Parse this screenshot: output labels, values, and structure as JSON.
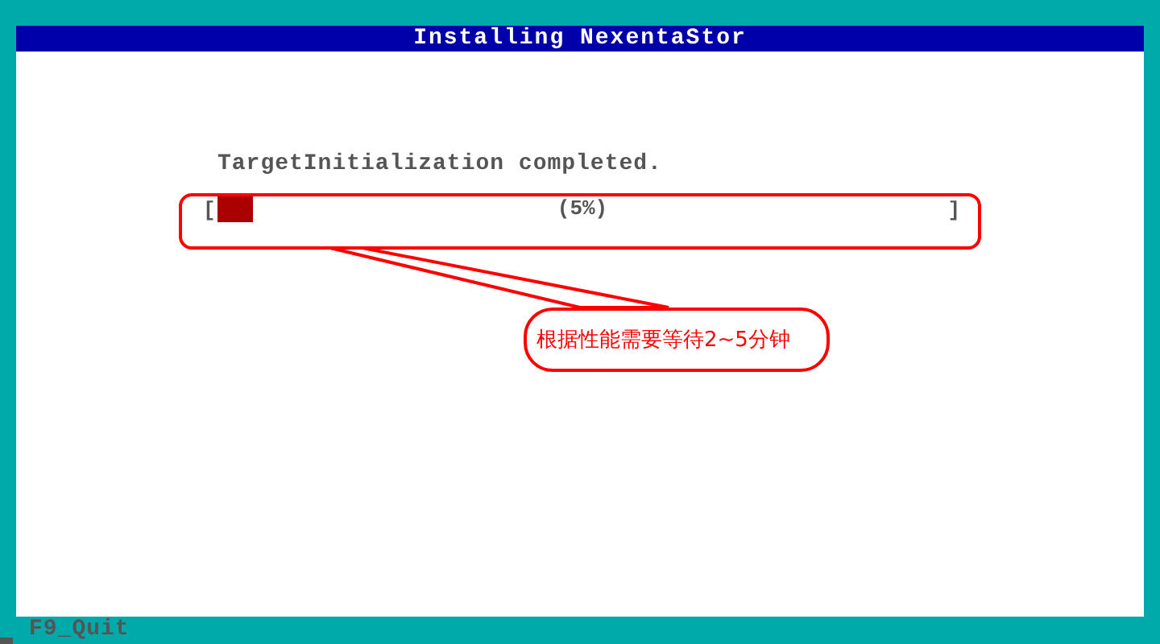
{
  "window": {
    "title": "Installing NexentaStor"
  },
  "status_message": "TargetInitialization completed.",
  "progress": {
    "open_bracket": "[",
    "close_bracket": "]",
    "reading": "(5%)",
    "level": 0.05
  },
  "annotation": {
    "text": "根据性能需要等待2~5分钟"
  },
  "footer": {
    "key_hint": "F9_Quit"
  }
}
